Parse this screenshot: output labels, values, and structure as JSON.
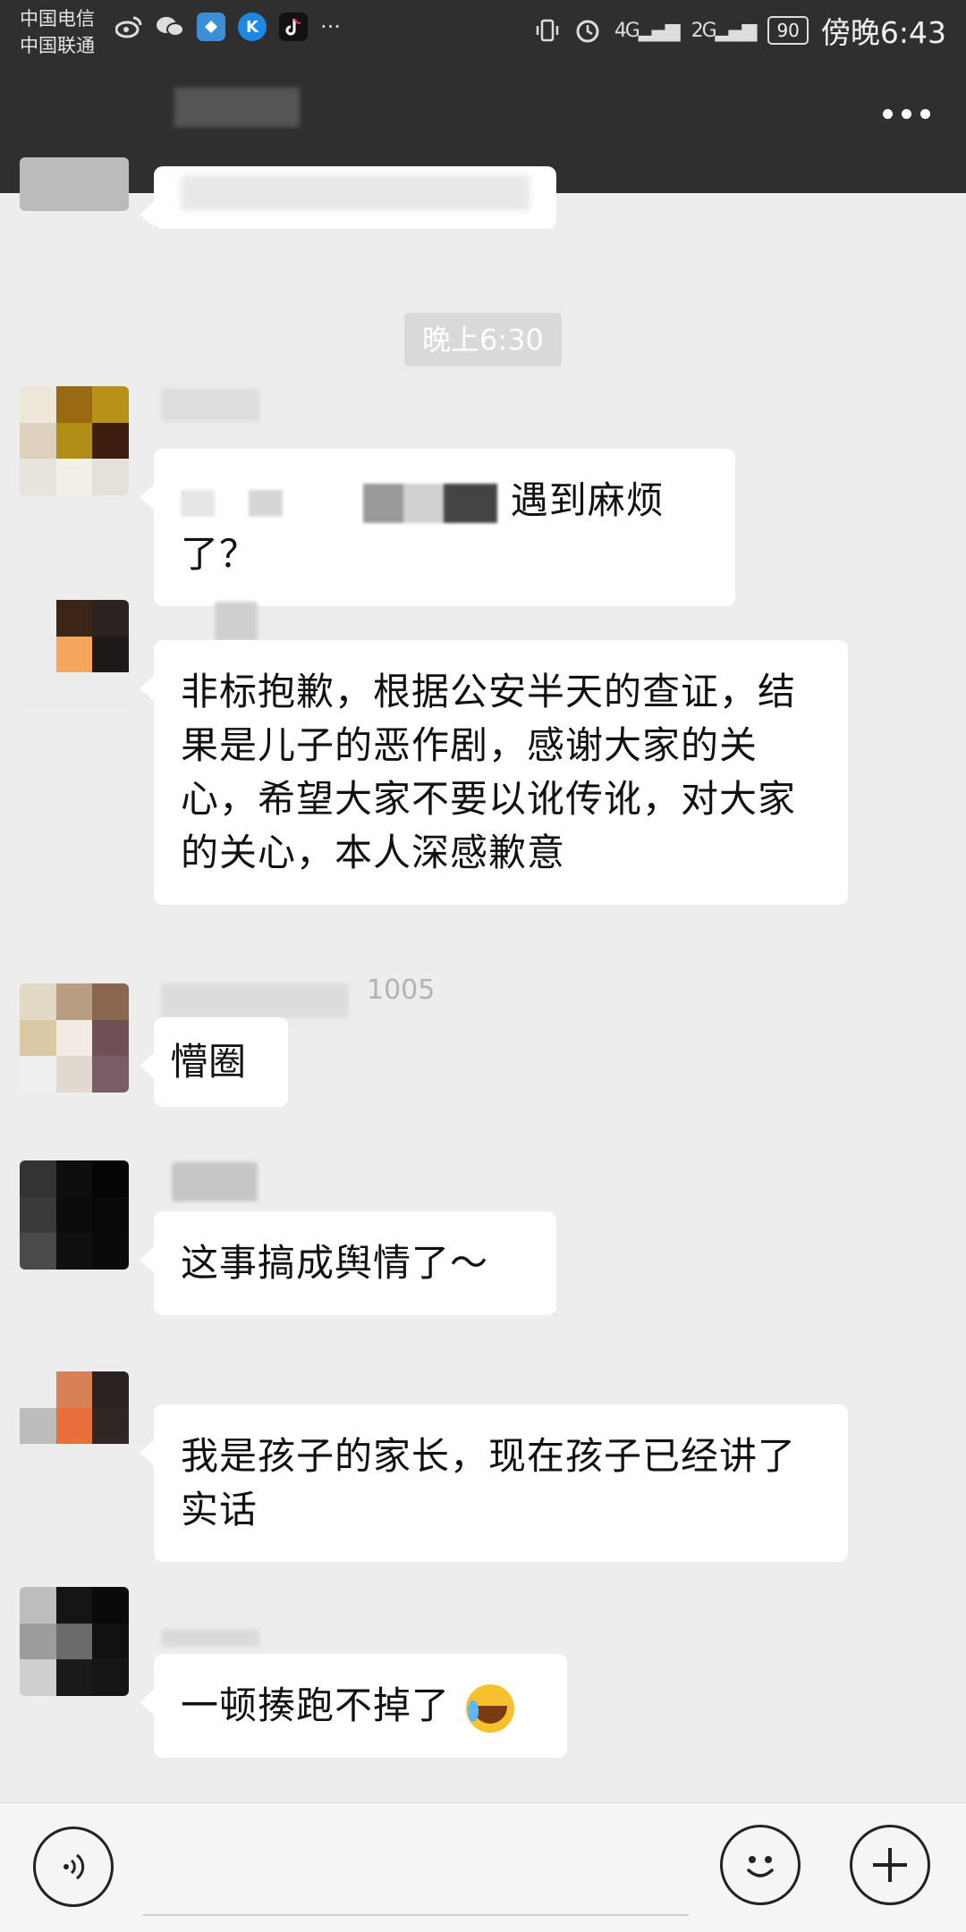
{
  "status_bar": {
    "carrier_1": "中国电信",
    "carrier_2": "中国联通",
    "notification_icons": [
      "weibo-icon",
      "wechat-icon",
      "app-icon",
      "kugou-icon",
      "tiktok-icon"
    ],
    "more": "···",
    "network_1": "4G",
    "network_2": "2G",
    "battery": "90",
    "time": "傍晚6:43"
  },
  "header": {
    "more_icon": "more-icon"
  },
  "chat": {
    "timestamp": "晚上6:30",
    "messages": [
      {
        "text": "遇到麻烦了？"
      },
      {
        "text": "非标抱歉，根据公安半天的查证，结果是儿子的恶作剧，感谢大家的关心，希望大家不要以讹传讹，对大家的关心，本人深感歉意"
      },
      {
        "name_suffix": "005",
        "text": "懵圈"
      },
      {
        "text": "这事搞成舆情了～"
      },
      {
        "text": "我是孩子的家长，现在孩子已经讲了实话"
      },
      {
        "text": "一顿揍跑不掉了",
        "emoji": "crying-laughing-emoji"
      }
    ]
  },
  "input_bar": {
    "voice_icon": "voice-icon",
    "emoji_icon": "emoji-icon",
    "plus_icon": "plus-icon"
  },
  "colors": {
    "header_bg": "#2f2f2f",
    "chat_bg": "#ededed",
    "bubble_bg": "#ffffff"
  }
}
